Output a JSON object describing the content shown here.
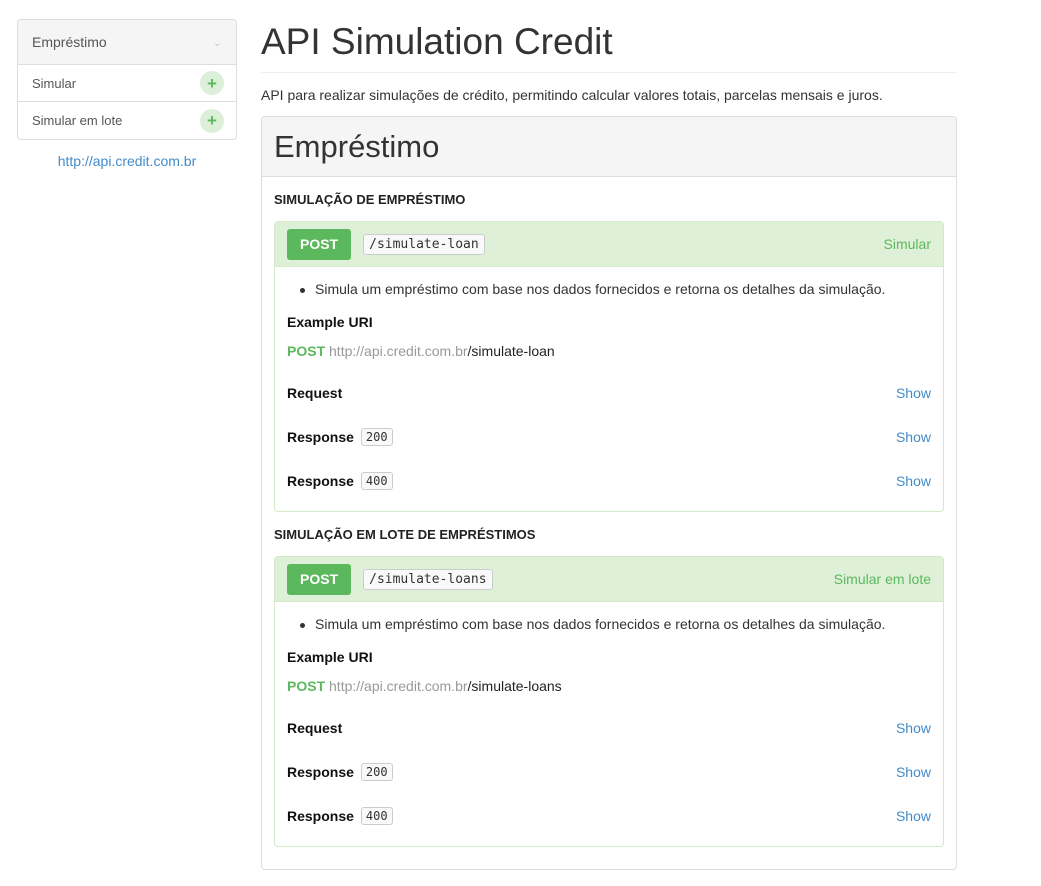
{
  "sidebar": {
    "header": "Empréstimo",
    "items": [
      {
        "label": "Simular"
      },
      {
        "label": "Simular em lote"
      }
    ],
    "host_link": "http://api.credit.com.br"
  },
  "main": {
    "title": "API Simulation Credit",
    "description": "API para realizar simulações de crédito, permitindo calcular valores totais, parcelas mensais e juros.",
    "group": {
      "title": "Empréstimo",
      "resources": [
        {
          "title": "SIMULAÇÃO DE EMPRÉSTIMO",
          "action": {
            "method": "POST",
            "path": "/simulate-loan",
            "name": "Simular",
            "bullet": "Simula um empréstimo com base nos dados fornecidos e retorna os detalhes da simulação.",
            "example_label": "Example URI",
            "uri_method": "POST",
            "uri_host": "http://api.credit.com.br",
            "uri_path": "/simulate-loan",
            "request_label": "Request",
            "response_label": "Response",
            "codes": [
              "200",
              "400"
            ],
            "show_label": "Show"
          }
        },
        {
          "title": "SIMULAÇÃO EM LOTE DE EMPRÉSTIMOS",
          "action": {
            "method": "POST",
            "path": "/simulate-loans",
            "name": "Simular em lote",
            "bullet": "Simula um empréstimo com base nos dados fornecidos e retorna os detalhes da simulação.",
            "example_label": "Example URI",
            "uri_method": "POST",
            "uri_host": "http://api.credit.com.br",
            "uri_path": "/simulate-loans",
            "request_label": "Request",
            "response_label": "Response",
            "codes": [
              "200",
              "400"
            ],
            "show_label": "Show"
          }
        }
      ]
    }
  },
  "colors": {
    "post_green": "#5cb85c",
    "action_header_bg": "#dff0d8",
    "link_blue": "#428bca",
    "panel_header_bg": "#f5f5f5"
  },
  "icons": {
    "sidebar_header": "chevron-down-icon",
    "sidebar_item": "plus-icon"
  }
}
